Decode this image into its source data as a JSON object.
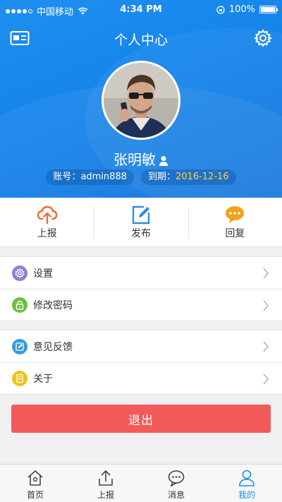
{
  "status_bar": {
    "carrier": "中国移动",
    "time": "4:34 PM",
    "battery": "100%"
  },
  "nav": {
    "title": "个人中心"
  },
  "profile": {
    "name": "张明敏",
    "account_label": "账号：",
    "account_value": "admin888",
    "expiry_label": "到期：",
    "expiry_value": "2016-12-16"
  },
  "actions": [
    {
      "label": "上报",
      "icon": "cloud-upload-icon",
      "color": "#e8703a"
    },
    {
      "label": "发布",
      "icon": "edit-icon",
      "color": "#2f8fe0"
    },
    {
      "label": "回复",
      "icon": "chat-bubble-icon",
      "color": "#f2a21a"
    }
  ],
  "menu_group_1": [
    {
      "label": "设置",
      "icon": "gear-icon",
      "color": "#8e7fd4"
    },
    {
      "label": "修改密码",
      "icon": "lock-icon",
      "color": "#6bbf3e"
    }
  ],
  "menu_group_2": [
    {
      "label": "意见反馈",
      "icon": "feedback-icon",
      "color": "#3a9be0"
    },
    {
      "label": "关于",
      "icon": "info-icon",
      "color": "#f2c21a"
    }
  ],
  "logout_label": "退出",
  "tabs": [
    {
      "label": "首页",
      "icon": "home-icon",
      "active": false
    },
    {
      "label": "上报",
      "icon": "upload-icon",
      "active": false
    },
    {
      "label": "消息",
      "icon": "message-icon",
      "active": false
    },
    {
      "label": "我的",
      "icon": "person-icon",
      "active": true
    }
  ],
  "colors": {
    "header_blue": "#1684ea",
    "accent_yellow": "#ffd23c",
    "logout_red": "#f25a5a",
    "tab_active": "#1a8cf0"
  }
}
